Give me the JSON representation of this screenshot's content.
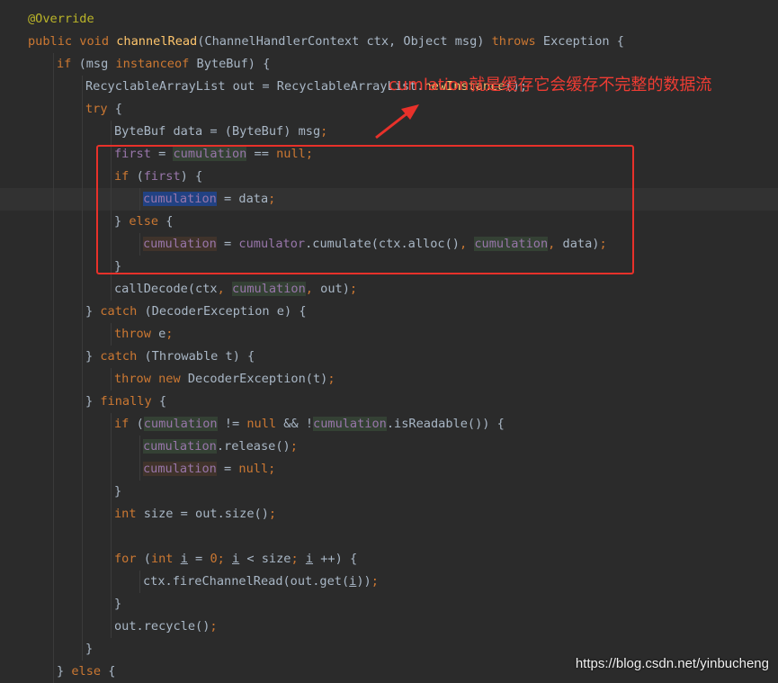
{
  "editor": {
    "lines": [
      [
        {
          "t": "@Override",
          "c": "ann"
        }
      ],
      [
        {
          "t": "public void ",
          "c": "kw"
        },
        {
          "t": "channelRead",
          "c": "fn"
        },
        {
          "t": "(ChannelHandlerContext ctx, Object msg) "
        },
        {
          "t": "throws ",
          "c": "kw"
        },
        {
          "t": "Exception {"
        }
      ],
      [
        {
          "t": "if ",
          "c": "kw"
        },
        {
          "t": "(msg "
        },
        {
          "t": "instanceof ",
          "c": "kw"
        },
        {
          "t": "ByteBuf) {"
        }
      ],
      [
        {
          "t": "RecyclableArrayList out = RecyclableArrayList."
        },
        {
          "t": "newInstance",
          "c": "fn"
        },
        {
          "t": "();"
        }
      ],
      [
        {
          "t": "try ",
          "c": "kw"
        },
        {
          "t": "{"
        }
      ],
      [
        {
          "t": "ByteBuf data = (ByteBuf) msg"
        },
        {
          "t": ";",
          "c": "kw"
        }
      ],
      [
        {
          "t": "first",
          "c": "fld"
        },
        {
          "t": " = "
        },
        {
          "t": "cumulation",
          "c": "fld hl-w"
        },
        {
          "t": " == "
        },
        {
          "t": "null",
          "c": "kw"
        },
        {
          "t": ";",
          "c": "kw"
        }
      ],
      [
        {
          "t": "if ",
          "c": "kw"
        },
        {
          "t": "("
        },
        {
          "t": "first",
          "c": "fld"
        },
        {
          "t": ") {"
        }
      ],
      [
        {
          "t": "cumulation",
          "c": "fld hl-s"
        },
        {
          "t": " = data"
        },
        {
          "t": ";",
          "c": "kw"
        }
      ],
      [
        {
          "t": "} "
        },
        {
          "t": "else ",
          "c": "kw"
        },
        {
          "t": "{"
        }
      ],
      [
        {
          "t": "cumulation",
          "c": "fld hl-r"
        },
        {
          "t": " = "
        },
        {
          "t": "cumulator",
          "c": "fld"
        },
        {
          "t": ".cumulate(ctx.alloc()"
        },
        {
          "t": ", ",
          "c": "kw"
        },
        {
          "t": "cumulation",
          "c": "fld hl-w"
        },
        {
          "t": ", ",
          "c": "kw"
        },
        {
          "t": "data)"
        },
        {
          "t": ";",
          "c": "kw"
        }
      ],
      [
        {
          "t": "}"
        }
      ],
      [
        {
          "t": "callDecode(ctx"
        },
        {
          "t": ", ",
          "c": "kw"
        },
        {
          "t": "cumulation",
          "c": "fld hl-w"
        },
        {
          "t": ", ",
          "c": "kw"
        },
        {
          "t": "out)"
        },
        {
          "t": ";",
          "c": "kw"
        }
      ],
      [
        {
          "t": "} "
        },
        {
          "t": "catch ",
          "c": "kw"
        },
        {
          "t": "(DecoderException e) {"
        }
      ],
      [
        {
          "t": "throw ",
          "c": "kw"
        },
        {
          "t": "e"
        },
        {
          "t": ";",
          "c": "kw"
        }
      ],
      [
        {
          "t": "} "
        },
        {
          "t": "catch ",
          "c": "kw"
        },
        {
          "t": "(Throwable t) {"
        }
      ],
      [
        {
          "t": "throw new ",
          "c": "kw"
        },
        {
          "t": "DecoderException(t)"
        },
        {
          "t": ";",
          "c": "kw"
        }
      ],
      [
        {
          "t": "} "
        },
        {
          "t": "finally ",
          "c": "kw"
        },
        {
          "t": "{"
        }
      ],
      [
        {
          "t": "if ",
          "c": "kw"
        },
        {
          "t": "("
        },
        {
          "t": "cumulation",
          "c": "fld hl-w"
        },
        {
          "t": " != "
        },
        {
          "t": "null ",
          "c": "kw"
        },
        {
          "t": "&& !"
        },
        {
          "t": "cumulation",
          "c": "fld hl-w"
        },
        {
          "t": ".isReadable()) {"
        }
      ],
      [
        {
          "t": "cumulation",
          "c": "fld hl-w"
        },
        {
          "t": ".release()"
        },
        {
          "t": ";",
          "c": "kw"
        }
      ],
      [
        {
          "t": "cumulation",
          "c": "fld hl-r"
        },
        {
          "t": " = "
        },
        {
          "t": "null",
          "c": "kw"
        },
        {
          "t": ";",
          "c": "kw"
        }
      ],
      [
        {
          "t": "}"
        }
      ],
      [
        {
          "t": "int ",
          "c": "kw"
        },
        {
          "t": "size = out.size()"
        },
        {
          "t": ";",
          "c": "kw"
        }
      ],
      [],
      [
        {
          "t": "for ",
          "c": "kw"
        },
        {
          "t": "("
        },
        {
          "t": "int ",
          "c": "kw"
        },
        {
          "t": "i",
          "c": "u"
        },
        {
          "t": " = "
        },
        {
          "t": "0",
          "c": "kw"
        },
        {
          "t": "; ",
          "c": "kw"
        },
        {
          "t": "i",
          "c": "u"
        },
        {
          "t": " < size"
        },
        {
          "t": "; ",
          "c": "kw"
        },
        {
          "t": "i",
          "c": "u"
        },
        {
          "t": " ++) {"
        }
      ],
      [
        {
          "t": "ctx.fireChannelRead(out.get("
        },
        {
          "t": "i",
          "c": "u"
        },
        {
          "t": "))"
        },
        {
          "t": ";",
          "c": "kw"
        }
      ],
      [
        {
          "t": "}"
        }
      ],
      [
        {
          "t": "out.recycle()"
        },
        {
          "t": ";",
          "c": "kw"
        }
      ],
      [
        {
          "t": "}"
        }
      ],
      [
        {
          "t": "} "
        },
        {
          "t": "else ",
          "c": "kw"
        },
        {
          "t": "{"
        }
      ]
    ]
  },
  "annotation": {
    "text": "cumlation就是缓存它会缓存不完整的数据流",
    "color": "#ef3c33"
  },
  "watermark": {
    "text": "https://blog.csdn.net/yinbucheng"
  },
  "colors": {
    "background": "#2b2b2b",
    "keyword": "#cc7832",
    "method": "#ffc66d",
    "field": "#9876aa",
    "annotation_code": "#bbb529",
    "text": "#a9b7c6",
    "highlight_box": "#e8312a"
  }
}
